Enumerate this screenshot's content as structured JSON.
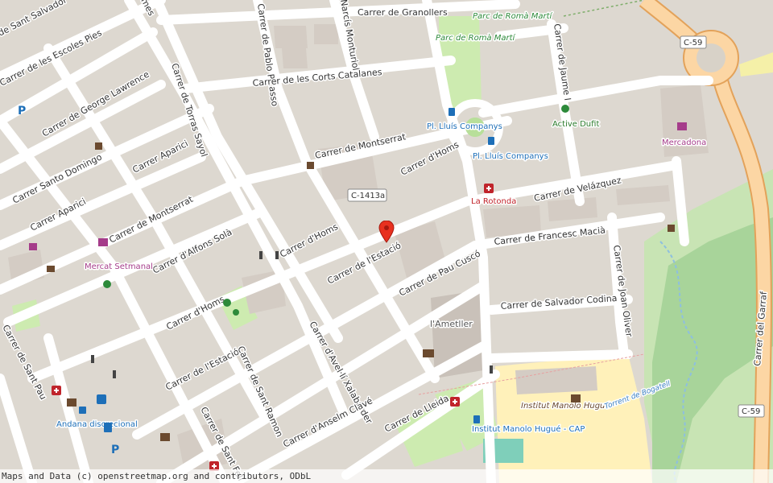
{
  "streets": {
    "granollers": "Carrer de Granollers",
    "sant_salvador": "de Sant Salvador",
    "escoles_pies": "Carrer de les Escoles Pies",
    "pablo_picasso": "Carrer de Pablo Picasso",
    "narcis_monturiol": "Narcís Monturiol",
    "corts_catalanes": "Carrer de les Corts Catalanes",
    "george_lawrence": "Carrer de George Lawrence",
    "torras_sayol": "Carrer de Torras Sayol",
    "montserrat_top": "Carrer de Montserrat",
    "homs_top": "Carrer d'Homs",
    "aparici_upper": "Carrer Aparici",
    "santo_domingo": "Carrer Santo Domingo",
    "aparici_lower": "Carrer Aparici",
    "montserrat_mid": "Carrer de Montserrat",
    "alfons_sola": "Carrer d'Alfons Solà",
    "homs_mid": "Carrer d'Homs",
    "estacio_mid": "Carrer de l'Estació",
    "pau_cusco": "Carrer de Pau Cuscó",
    "velazquez": "Carrer de Velázquez",
    "francesc_macia": "Carrer de Francesc Macià",
    "salvador_codina": "Carrer de Salvador Codina",
    "joan_oliver": "Carrer de Joan Oliver",
    "jaume_i": "Carrer de Jaume I",
    "homs_low": "Carrer d'Homs",
    "estacio_low": "Carrer de l'Estació",
    "sant_ramon": "Carrer de Sant Ramon",
    "avelli_xalabarder": "Carrer d'Avel·lí Xalabarder",
    "anselm_clave": "Carrer d'Anselm Clavé",
    "lleida": "Carrer de Lleida",
    "sant_pau": "Carrer de Sant Pau",
    "sant_felip": "Carrer de Sant Feli",
    "garraf": "Carrer del Garraf",
    "ames": "mes"
  },
  "road_shields": {
    "c59_top": "C-59",
    "c1413a": "C-1413a",
    "c59_bottom": "C-59"
  },
  "places": {
    "parc_romo_marti_1": "Parc de Romà Martí",
    "parc_romo_marti_2": "Parc de Romà Martí",
    "lluis_companys_1": "Pl. Lluís Companys",
    "lluis_companys_2": "Pl. Lluís Companys",
    "active_dufit": "Active Dufit",
    "mercadona": "Mercadona",
    "la_rotonda": "La Rotonda",
    "mercat_setmanal": "Mercat Setmanal",
    "ametller": "l'Ametller",
    "institut_manolo_hugue": "Institut Manolo Hugué",
    "institut_cap": "Institut Manolo Hugué - CAP",
    "andana": "Andana discrecional",
    "torrent_bogatell": "Torrent de Bogatell"
  },
  "attribution": "Maps and Data (c) openstreetmap.org and contributors, ODbL",
  "colors": {
    "background": "#f2efe9",
    "building": "#d9d0c9",
    "road": "#ffffff",
    "primary_road": "#fcd6a4",
    "park": "#cdebb0",
    "school": "#fff1ba",
    "marker": "#e8311f",
    "water": "#aad3df"
  }
}
